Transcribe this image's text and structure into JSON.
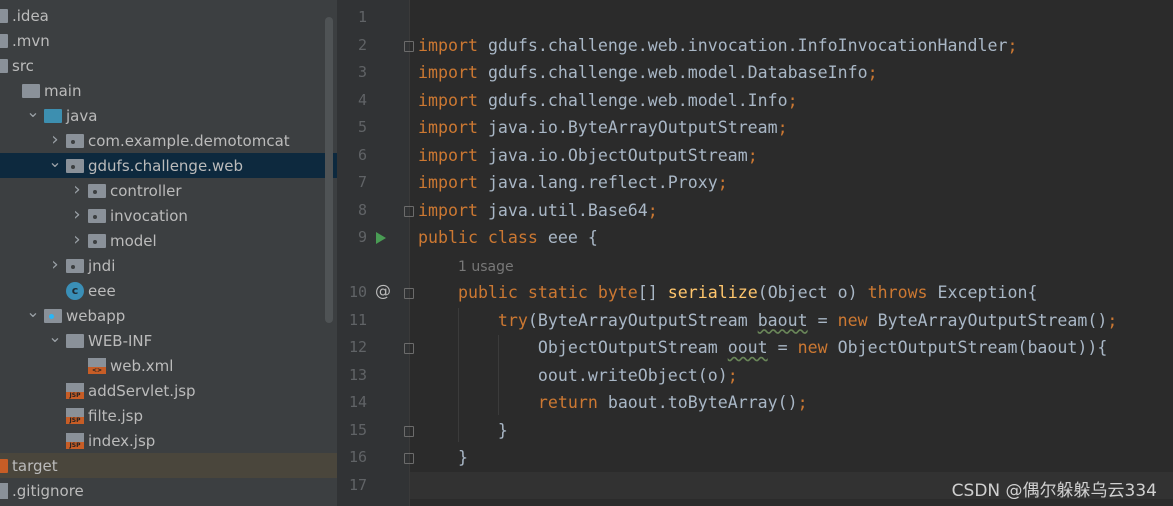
{
  "tree": [
    {
      "label": ".idea",
      "level": 0,
      "icon": "folder"
    },
    {
      "label": ".mvn",
      "level": 0,
      "icon": "folder"
    },
    {
      "label": "src",
      "level": 0,
      "icon": "folder"
    },
    {
      "label": "main",
      "level": 1,
      "icon": "folder"
    },
    {
      "label": "java",
      "level": 2,
      "icon": "folder-source",
      "arrow": "open"
    },
    {
      "label": "com.example.demotomcat",
      "level": 3,
      "icon": "package",
      "arrow": "closed"
    },
    {
      "label": "gdufs.challenge.web",
      "level": 3,
      "icon": "package",
      "arrow": "open",
      "selected": true
    },
    {
      "label": "controller",
      "level": 4,
      "icon": "package",
      "arrow": "closed"
    },
    {
      "label": "invocation",
      "level": 4,
      "icon": "package",
      "arrow": "closed"
    },
    {
      "label": "model",
      "level": 4,
      "icon": "package",
      "arrow": "closed"
    },
    {
      "label": "jndi",
      "level": 3,
      "icon": "package",
      "arrow": "closed"
    },
    {
      "label": "eee",
      "level": 3,
      "icon": "java-class"
    },
    {
      "label": "webapp",
      "level": 2,
      "icon": "folder-web",
      "arrow": "open"
    },
    {
      "label": "WEB-INF",
      "level": 3,
      "icon": "folder",
      "arrow": "open"
    },
    {
      "label": "web.xml",
      "level": 4,
      "icon": "xml-file"
    },
    {
      "label": "addServlet.jsp",
      "level": 3,
      "icon": "jsp-file"
    },
    {
      "label": "filte.jsp",
      "level": 3,
      "icon": "jsp-file"
    },
    {
      "label": "index.jsp",
      "level": 3,
      "icon": "jsp-file"
    },
    {
      "label": "target",
      "level": 0,
      "icon": "folder-excluded",
      "excluded": true
    },
    {
      "label": ".gitignore",
      "level": 0,
      "icon": "ignore-file"
    }
  ],
  "editor": {
    "lines": [
      {
        "n": "1",
        "t": []
      },
      {
        "n": "2",
        "t": [
          [
            "import ",
            "kw"
          ],
          [
            "gdufs.challenge.web.invocation.InfoInvocationHandler",
            "tx"
          ],
          [
            ";",
            "kw"
          ]
        ]
      },
      {
        "n": "3",
        "t": [
          [
            "import ",
            "kw"
          ],
          [
            "gdufs.challenge.web.model.DatabaseInfo",
            "tx"
          ],
          [
            ";",
            "kw"
          ]
        ]
      },
      {
        "n": "4",
        "t": [
          [
            "import ",
            "kw"
          ],
          [
            "gdufs.challenge.web.model.Info",
            "tx"
          ],
          [
            ";",
            "kw"
          ]
        ]
      },
      {
        "n": "5",
        "t": [
          [
            "import ",
            "kw"
          ],
          [
            "java.io.ByteArrayOutputStream",
            "tx"
          ],
          [
            ";",
            "kw"
          ]
        ]
      },
      {
        "n": "6",
        "t": [
          [
            "import ",
            "kw"
          ],
          [
            "java.io.ObjectOutputStream",
            "tx"
          ],
          [
            ";",
            "kw"
          ]
        ]
      },
      {
        "n": "7",
        "t": [
          [
            "import ",
            "kw"
          ],
          [
            "java.lang.reflect.Proxy",
            "tx"
          ],
          [
            ";",
            "kw"
          ]
        ]
      },
      {
        "n": "8",
        "t": [
          [
            "import ",
            "kw"
          ],
          [
            "java.util.Base64",
            "tx"
          ],
          [
            ";",
            "kw"
          ]
        ]
      },
      {
        "n": "9",
        "t": [
          [
            "public class ",
            "kw"
          ],
          [
            "eee {",
            "tx"
          ]
        ]
      },
      {
        "n": "",
        "usage": "1 usage"
      },
      {
        "n": "10",
        "t": [
          [
            "    public static byte",
            "kw"
          ],
          [
            "[] ",
            "tx"
          ],
          [
            "serialize",
            "fn"
          ],
          [
            "(Object o) ",
            "tx"
          ],
          [
            "throws ",
            "kw"
          ],
          [
            "Exception{",
            "tx"
          ]
        ]
      },
      {
        "n": "11",
        "t": [
          [
            "        try",
            "kw"
          ],
          [
            "(ByteArrayOutputStream ",
            "tx"
          ],
          [
            "baout",
            "ul"
          ],
          [
            " = ",
            "tx"
          ],
          [
            "new ",
            "kw"
          ],
          [
            "ByteArrayOutputStream()",
            "tx"
          ],
          [
            ";",
            "kw"
          ]
        ]
      },
      {
        "n": "12",
        "t": [
          [
            "            ObjectOutputStream ",
            "tx"
          ],
          [
            "oout",
            "ul"
          ],
          [
            " = ",
            "tx"
          ],
          [
            "new ",
            "kw"
          ],
          [
            "ObjectOutputStream(baout)){",
            "tx"
          ]
        ]
      },
      {
        "n": "13",
        "t": [
          [
            "            oout.writeObject(o)",
            "tx"
          ],
          [
            ";",
            "kw"
          ]
        ]
      },
      {
        "n": "14",
        "t": [
          [
            "            return ",
            "kw"
          ],
          [
            "baout.toByteArray()",
            "tx"
          ],
          [
            ";",
            "kw"
          ]
        ]
      },
      {
        "n": "15",
        "t": [
          [
            "        }",
            "tx"
          ]
        ]
      },
      {
        "n": "16",
        "t": [
          [
            "    }",
            "tx"
          ]
        ]
      },
      {
        "n": "17",
        "t": []
      }
    ]
  },
  "watermark": "CSDN @偶尔躲躲乌云334",
  "colors": {
    "keyword": "#cc7832",
    "method": "#ffc66d",
    "text": "#a9b7c6",
    "selection": "#0d293e"
  }
}
